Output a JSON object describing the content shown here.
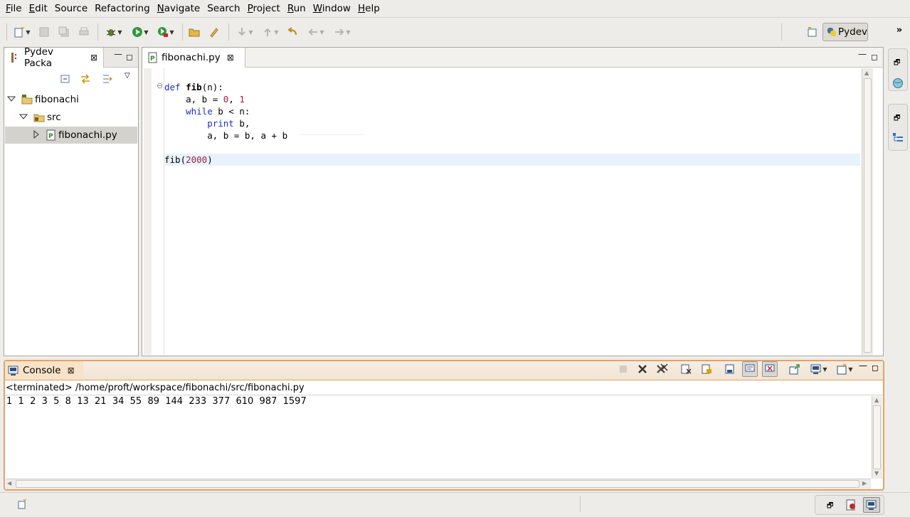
{
  "menu": [
    "File",
    "Edit",
    "Source",
    "Refactoring",
    "Navigate",
    "Search",
    "Project",
    "Run",
    "Window",
    "Help"
  ],
  "menu_mnemonics": [
    "F",
    "E",
    "",
    "",
    "N",
    "",
    "P",
    "R",
    "W",
    "H"
  ],
  "toolbar": {
    "perspective_label": "Pydev"
  },
  "package_explorer": {
    "tab_label": "Pydev Packa",
    "tree": [
      {
        "label": "fibonachi"
      },
      {
        "label": "src"
      },
      {
        "label": "fibonachi.py"
      }
    ]
  },
  "editor": {
    "tab_label": "fibonachi.py",
    "lines": {
      "l1_kw": "def ",
      "l1_fn": "fib",
      "l1_rest": "(n):",
      "l2_a": "    a, b = ",
      "l2_n0": "0",
      "l2_c": ", ",
      "l2_n1": "1",
      "l3_kw": "    while",
      "l3_rest": " b < n:",
      "l4_kw": "        print",
      "l4_rest": " b,",
      "l5": "        a, b = b, a + b",
      "l7_a": "fib(",
      "l7_n": "2000",
      "l7_b": ")"
    }
  },
  "console": {
    "tab_label": "Console",
    "header": "<terminated> /home/proft/workspace/fibonachi/src/fibonachi.py",
    "output": "1  1  2  3  5  8  13  21  34  55  89  144  233  377  610  987  1597"
  },
  "colors": {
    "accent_border": "#e0a36c",
    "current_line": "#e8f2fe",
    "keyword": "#1e2ec8",
    "number": "#a3213b"
  }
}
